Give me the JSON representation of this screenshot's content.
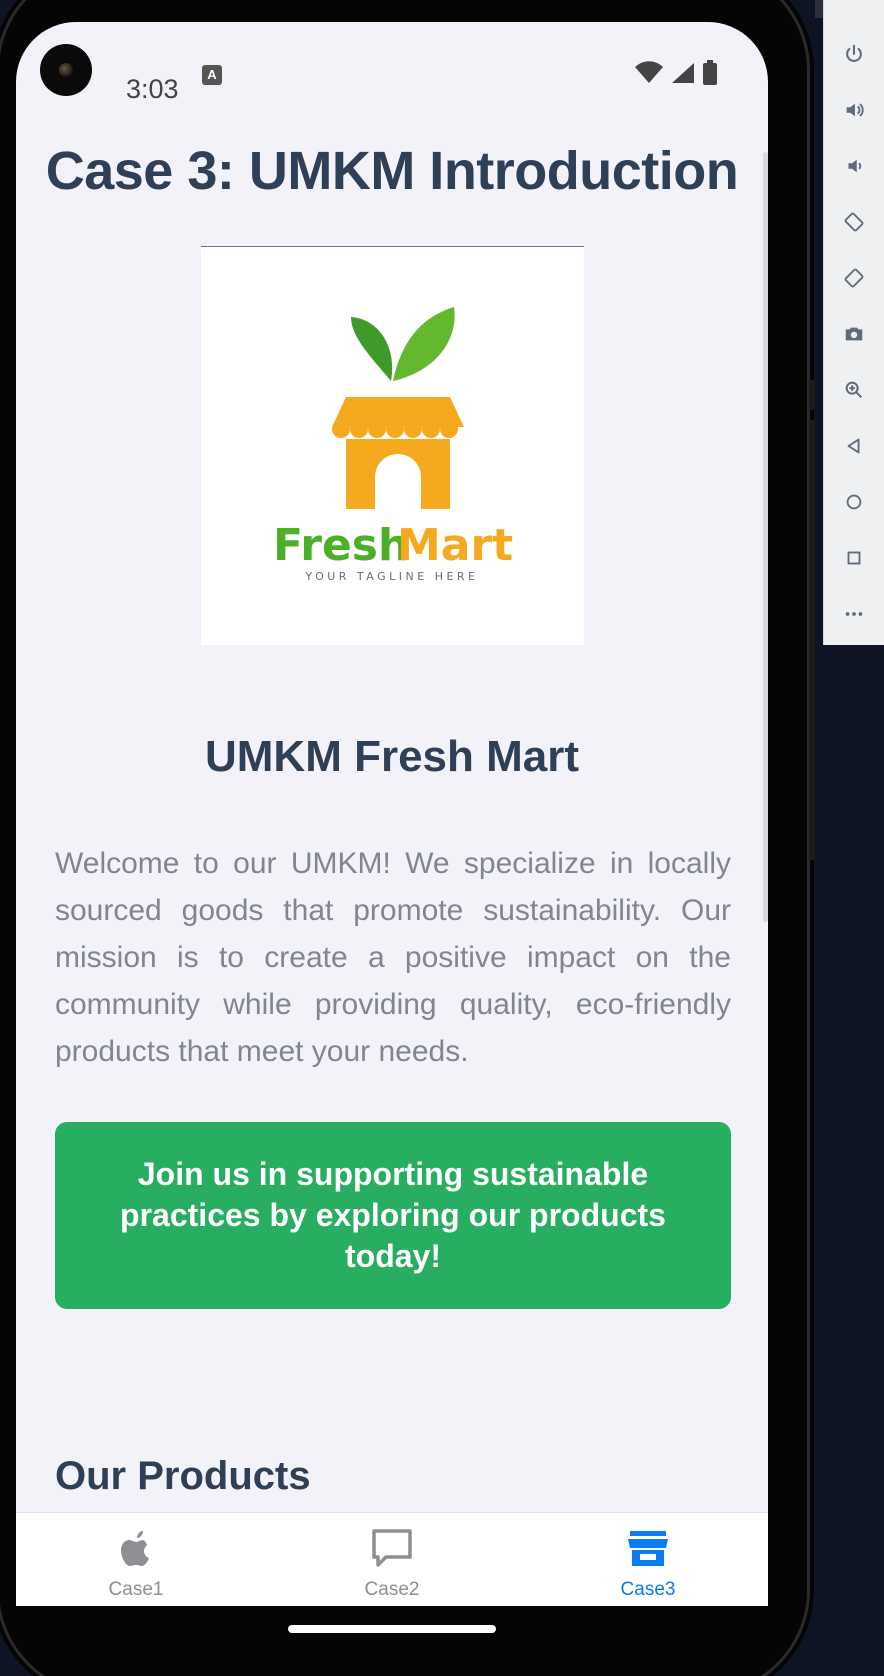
{
  "status_bar": {
    "time": "3:03",
    "notification_badge": "A"
  },
  "page": {
    "title": "Case 3: UMKM Introduction",
    "logo": {
      "brand_fresh": "Fresh",
      "brand_mart": "Mart",
      "tagline": "YOUR TAGLINE HERE"
    },
    "store_name": "UMKM Fresh Mart",
    "description": "Welcome to our UMKM! We specialize in locally sourced goods that promote sustainability. Our mission is to create a positive impact on the community while providing quality, eco-friendly products that meet your needs.",
    "cta_text": "Join us in supporting sustainable practices by exploring our products today!",
    "products_heading": "Our Products"
  },
  "tabs": [
    {
      "label": "Case1",
      "icon": "apple-icon",
      "active": false
    },
    {
      "label": "Case2",
      "icon": "chat-bubble-icon",
      "active": false
    },
    {
      "label": "Case3",
      "icon": "store-icon",
      "active": true
    }
  ],
  "emulator_toolbar": [
    "power-icon",
    "volume-up-icon",
    "volume-down-icon",
    "rotate-left-icon",
    "rotate-right-icon",
    "camera-icon",
    "zoom-icon",
    "back-icon",
    "home-icon",
    "overview-icon",
    "more-icon"
  ],
  "colors": {
    "heading": "#2f3f56",
    "body_text": "#808690",
    "cta_background": "#27ae60",
    "active_tab": "#0a7af5",
    "inactive_tab": "#8e8e93",
    "screen_background": "#f3f2f8"
  }
}
